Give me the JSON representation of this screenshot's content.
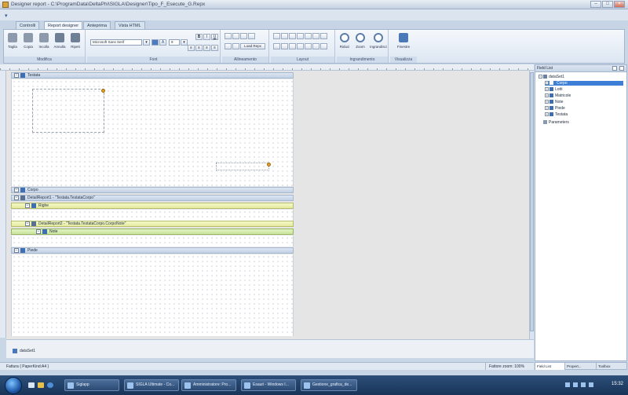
{
  "window": {
    "title": "Designer report - C:\\ProgramData\\DeltaPhi\\SIGLA\\Designer\\Tipo_F_Esecute_G.Repx"
  },
  "tabs": [
    "Controlli",
    "Report designer",
    "Anteprima",
    "Vista HTML"
  ],
  "ribbon": {
    "groups": {
      "modifica": {
        "label": "Modifica",
        "buttons": [
          "Taglia",
          "Copia",
          "Incolla",
          "Annulla",
          "Ripeti"
        ]
      },
      "font": {
        "label": "Font",
        "font_name": "Microsoft Sans Serif",
        "font_size": "9",
        "bold": "B",
        "italic": "I",
        "underline": "U"
      },
      "allineamento": {
        "label": "Allineamento",
        "load_label": "Load Repx"
      },
      "layout": {
        "label": "Layout"
      },
      "ingrandimento": {
        "label": "Ingrandimento",
        "buttons": [
          "Riduci",
          "Zoom",
          "Ingrandisci"
        ]
      },
      "visualizza": {
        "label": "Visualizza",
        "buttons": [
          "Finestre"
        ]
      }
    }
  },
  "bands": [
    {
      "name": "Testata",
      "tone": "blue"
    },
    {
      "name": "Corpo",
      "tone": "blue"
    },
    {
      "name": "DetailReport1 - \"Testata.TestataCorpo\"",
      "tone": "blue"
    },
    {
      "name": "Righe",
      "tone": "yellow"
    },
    {
      "name": "DetailReport2 - \"Testata.TestataCorpo.CorpoNote\"",
      "tone": "yellow"
    },
    {
      "name": "Note",
      "tone": "green"
    },
    {
      "name": "Piede",
      "tone": "blue"
    }
  ],
  "bottom": {
    "component": "dataSet1"
  },
  "status": {
    "left": "Fattura { PaperKind:A4 }",
    "zoom": "Fattore zoom: 100%"
  },
  "field_list": {
    "title": "Field List",
    "tree": [
      {
        "label": "dataSet1",
        "level": 0
      },
      {
        "label": "Corpo",
        "level": 1,
        "selected": true
      },
      {
        "label": "Lotti",
        "level": 1
      },
      {
        "label": "Matricole",
        "level": 1
      },
      {
        "label": "Note",
        "level": 1
      },
      {
        "label": "Piede",
        "level": 1
      },
      {
        "label": "Testata",
        "level": 1
      },
      {
        "label": "Parameters",
        "level": 0
      }
    ]
  },
  "right_tabs": [
    "Field List",
    "Propert...",
    "Toolbox"
  ],
  "taskbar": {
    "items": [
      "Siglapp",
      "SIGLA Ultimate - Co...",
      "Amministratore: Pro...",
      "Esauri - Windows I...",
      "Gestione_grafica_de..."
    ],
    "clock": "15:32"
  },
  "colors": {
    "accent": "#3d7fd6",
    "band_yellow": "#e4ea9d",
    "band_green": "#c9e59a"
  }
}
